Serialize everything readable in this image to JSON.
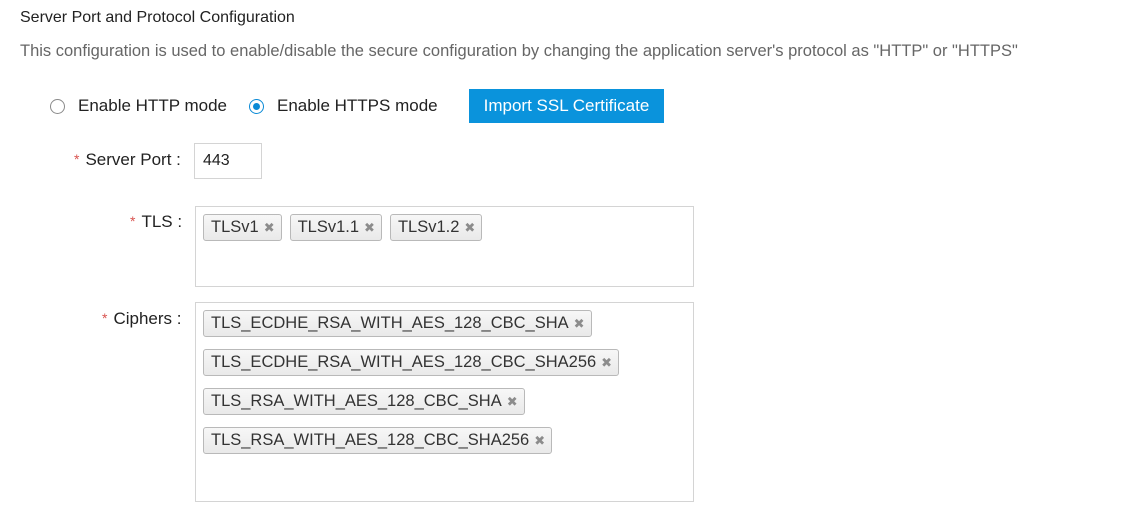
{
  "section": {
    "title": "Server Port and Protocol Configuration",
    "description": "This configuration is used to enable/disable the secure configuration by changing the application server's protocol as \"HTTP\" or \"HTTPS\""
  },
  "mode": {
    "http_label": "Enable HTTP mode",
    "https_label": "Enable HTTPS mode",
    "selected": "https",
    "import_button_label": "Import SSL Certificate"
  },
  "server_port": {
    "label": "Server Port :",
    "value": "443"
  },
  "tls": {
    "label": "TLS :",
    "tags": [
      "TLSv1",
      "TLSv1.1",
      "TLSv1.2"
    ]
  },
  "ciphers": {
    "label": "Ciphers :",
    "tags": [
      "TLS_ECDHE_RSA_WITH_AES_128_CBC_SHA",
      "TLS_ECDHE_RSA_WITH_AES_128_CBC_SHA256",
      "TLS_RSA_WITH_AES_128_CBC_SHA",
      "TLS_RSA_WITH_AES_128_CBC_SHA256"
    ]
  },
  "required_marker": "*",
  "remove_icon": "close-icon",
  "colors": {
    "accent": "#0a93dc",
    "required": "#d9534f"
  }
}
